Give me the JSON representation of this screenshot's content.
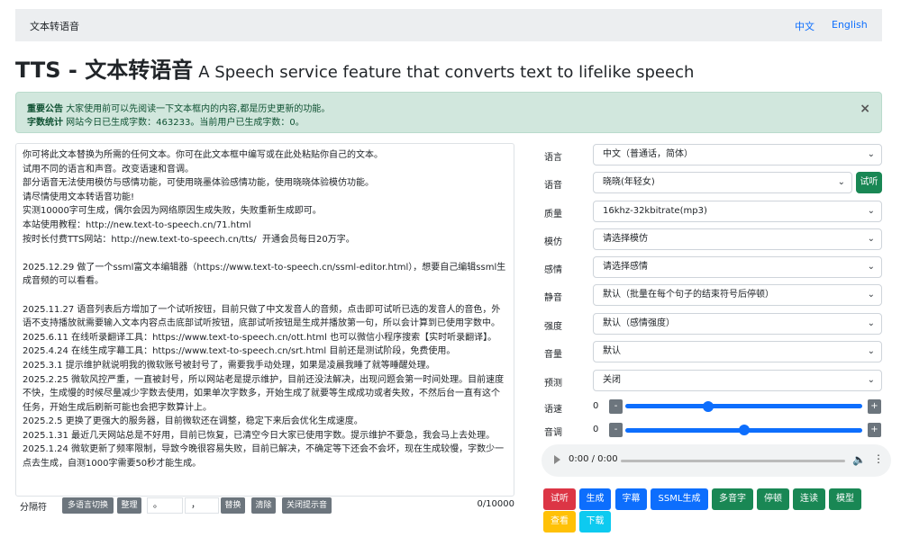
{
  "nav": {
    "brand": "文本转语音",
    "lang_zh": "中文",
    "lang_en": "English"
  },
  "header": {
    "title": "TTS - 文本转语音",
    "subtitle": "A Speech service feature that converts text to lifelike speech"
  },
  "alert": {
    "notice_label": "重要公告",
    "notice_text": " 大家使用前可以先阅读一下文本框内的内容,都是历史更新的功能。",
    "stats_label": "字数统计",
    "stats_text": " 网站今日已生成字数：463233。当前用户已生成字数：0。",
    "close": "×"
  },
  "editor": {
    "text": "你可将此文本替换为所需的任何文本。你可在此文本框中编写或在此处粘贴你自己的文本。\n试用不同的语言和声音。改变语速和音调。\n部分语音无法使用模仿与感情功能，可使用晓墨体验感情功能，使用晓晓体验模仿功能。\n请尽情使用文本转语音功能!\n实测10000字可生成，偶尔会因为网络原因生成失败，失败重新生成即可。\n本站使用教程：http://new.text-to-speech.cn/71.html\n按时长付费TTS网站：http://new.text-to-speech.cn/tts/  开通会员每日20万字。\n\n2025.12.29 做了一个ssml富文本编辑器（https://www.text-to-speech.cn/ssml-editor.html），想要自己编辑ssml生成音频的可以看看。\n\n2025.11.27 语音列表后方增加了一个试听按钮，目前只做了中文发音人的音频，点击即可试听已选的发音人的音色，外语不支持播放就需要输入文本内容点击底部试听按钮，底部试听按钮是生成并播放第一句，所以会计算到已使用字数中。\n2025.6.11 在线听录翻译工具：https://www.text-to-speech.cn/ott.html 也可以微信小程序搜索【实时听录翻译】。\n2025.4.24 在线生成字幕工具：https://www.text-to-speech.cn/srt.html 目前还是测试阶段，免费使用。\n2025.3.1 提示维护就说明我的微软账号被封号了，需要我手动处理，如果是凌晨我睡了就等睡醒处理。\n2025.2.25 微软风控严重，一直被封号，所以网站老是提示维护，目前还没法解决，出现问题会第一时间处理。目前速度不快，生成慢的时候尽量减少字数去使用，如果单次字数多，开始生成了就要等生成成功或者失败，不然后台一直有这个任务，开始生成后刷新可能也会把字数算计上。\n2025.2.5 更换了更强大的服务器，目前微软还在调整，稳定下来后会优化生成速度。\n2025.1.31 最近几天网站总是不好用，目前已恢复，已清空今日大家已使用字数。提示维护不要急，我会马上去处理。\n2025.1.24 微软更新了频率限制，导致今晚很容易失败，目前已解决，不确定等下还会不会坏，现在生成较慢，字数少一点去生成，自测1000字需要50秒才能生成。",
    "char_count": "0/10000"
  },
  "toolbar": {
    "separator_label": "分隔符",
    "multilang_btn": "多语言切换",
    "tidy_btn": "整理",
    "find_value": "。",
    "replace_value": "，",
    "replace_btn": "替换",
    "clear_btn": "清除",
    "close_tip_btn": "关闭提示音"
  },
  "settings": {
    "language": {
      "label": "语言",
      "value": "中文（普通话，简体）"
    },
    "voice": {
      "label": "语音",
      "value": "晓晓(年轻女)",
      "try_btn": "试听"
    },
    "quality": {
      "label": "质量",
      "value": "16khz-32kbitrate(mp3)"
    },
    "imitate": {
      "label": "模仿",
      "value": "请选择模仿"
    },
    "emotion": {
      "label": "感情",
      "value": "请选择感情"
    },
    "silence": {
      "label": "静音",
      "value": "默认（批量在每个句子的结束符号后停顿）"
    },
    "intensity": {
      "label": "强度",
      "value": "默认（感情强度）"
    },
    "volume": {
      "label": "音量",
      "value": "默认"
    },
    "predict": {
      "label": "预测",
      "value": "关闭"
    },
    "rate": {
      "label": "语速",
      "value": "0",
      "minus": "-",
      "plus": "+",
      "level": 0.35
    },
    "pitch": {
      "label": "音调",
      "value": "0",
      "minus": "-",
      "plus": "+",
      "level": 0.5
    }
  },
  "audio": {
    "time": "0:00 / 0:00"
  },
  "actions": [
    {
      "label": "试听",
      "color": "#dc3545"
    },
    {
      "label": "生成",
      "color": "#0d6efd"
    },
    {
      "label": "字幕",
      "color": "#0d6efd"
    },
    {
      "label": "SSML生成",
      "color": "#0d6efd"
    },
    {
      "label": "多音字",
      "color": "#198754"
    },
    {
      "label": "停顿",
      "color": "#198754"
    },
    {
      "label": "连读",
      "color": "#198754"
    },
    {
      "label": "模型",
      "color": "#198754"
    },
    {
      "label": "查看",
      "color": "#ffc107"
    },
    {
      "label": "下载",
      "color": "#0dcaf0"
    }
  ]
}
